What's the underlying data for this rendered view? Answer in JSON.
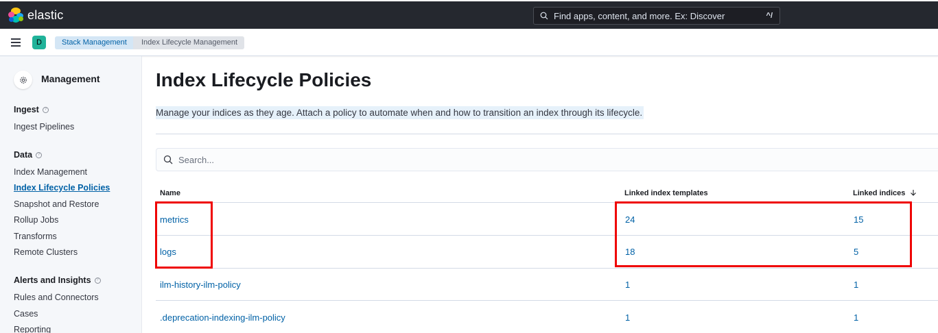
{
  "header": {
    "brand": "elastic",
    "search_placeholder": "Find apps, content, and more. Ex: Discover",
    "search_shortcut": "^/"
  },
  "subheader": {
    "space_initial": "D",
    "breadcrumbs": [
      "Stack Management",
      "Index Lifecycle Management"
    ]
  },
  "sidebar": {
    "title": "Management",
    "sections": [
      {
        "heading": "Ingest",
        "items": [
          "Ingest Pipelines"
        ]
      },
      {
        "heading": "Data",
        "items": [
          "Index Management",
          "Index Lifecycle Policies",
          "Snapshot and Restore",
          "Rollup Jobs",
          "Transforms",
          "Remote Clusters"
        ]
      },
      {
        "heading": "Alerts and Insights",
        "items": [
          "Rules and Connectors",
          "Cases",
          "Reporting"
        ]
      }
    ],
    "active_item": "Index Lifecycle Policies"
  },
  "main": {
    "title": "Index Lifecycle Policies",
    "description": "Manage your indices as they age. Attach a policy to automate when and how to transition an index through its lifecycle.",
    "search_placeholder": "Search...",
    "table": {
      "columns": [
        "Name",
        "Linked index templates",
        "Linked indices"
      ],
      "rows": [
        {
          "name": "metrics",
          "templates": "24",
          "indices": "15"
        },
        {
          "name": "logs",
          "templates": "18",
          "indices": "5"
        },
        {
          "name": "ilm-history-ilm-policy",
          "templates": "1",
          "indices": "1"
        },
        {
          "name": ".deprecation-indexing-ilm-policy",
          "templates": "1",
          "indices": "1"
        }
      ]
    }
  },
  "colors": {
    "header_bg": "#25282f",
    "link": "#0061a6",
    "highlight_box": "#ef0000",
    "space_avatar": "#20b39a"
  }
}
